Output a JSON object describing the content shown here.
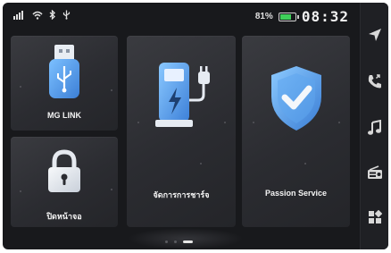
{
  "status_bar": {
    "signal_icon": "signal-icon",
    "wifi_icon": "wifi-icon",
    "bluetooth_icon": "bluetooth-icon",
    "usb_icon": "usb-icon",
    "battery_percent": "81%",
    "battery_level": 0.81,
    "battery_color": "#3fd05a",
    "time": "08:32"
  },
  "tiles": [
    {
      "label": "MG LINK",
      "icon": "usb-drive-icon"
    },
    {
      "label": "ปิดหน้าจอ",
      "icon": "lock-icon"
    },
    {
      "label": "จัดการการชาร์จ",
      "icon": "ev-charger-icon"
    },
    {
      "label": "Passion Service",
      "icon": "shield-check-icon"
    }
  ],
  "rail": {
    "items": [
      "navigation-icon",
      "phone-icon",
      "music-icon",
      "radio-icon",
      "apps-icon"
    ]
  },
  "pager": {
    "pages": 3,
    "active": 2
  },
  "colors": {
    "accent_blue": "#5aa3ee",
    "background": "#18191c",
    "tile": "#2f3035"
  }
}
